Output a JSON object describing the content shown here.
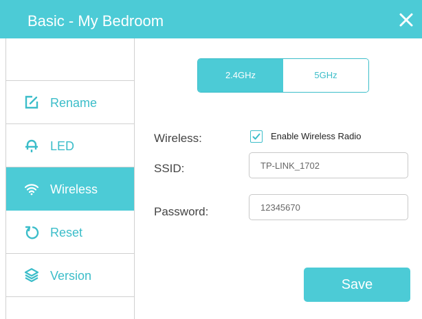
{
  "window": {
    "title": "Basic - My Bedroom",
    "close_icon": "close-icon"
  },
  "sidebar": {
    "items": [
      {
        "label": "Rename",
        "icon": "rename-icon",
        "active": false
      },
      {
        "label": "LED",
        "icon": "led-bell-icon",
        "active": false
      },
      {
        "label": "Wireless",
        "icon": "wifi-icon",
        "active": true
      },
      {
        "label": "Reset",
        "icon": "reset-icon",
        "active": false
      },
      {
        "label": "Version",
        "icon": "version-layers-icon",
        "active": false
      }
    ]
  },
  "bands": {
    "options": [
      "2.4GHz",
      "5GHz"
    ],
    "selected": "2.4GHz"
  },
  "form": {
    "wireless_label": "Wireless:",
    "enable_radio_label": "Enable Wireless Radio",
    "enable_radio_checked": true,
    "ssid_label": "SSID:",
    "ssid_value": "TP-LINK_1702",
    "password_label": "Password:",
    "password_value": "12345670"
  },
  "actions": {
    "save_label": "Save"
  },
  "colors": {
    "accent": "#4ccbd6",
    "accent_text": "#3bbdc9"
  }
}
